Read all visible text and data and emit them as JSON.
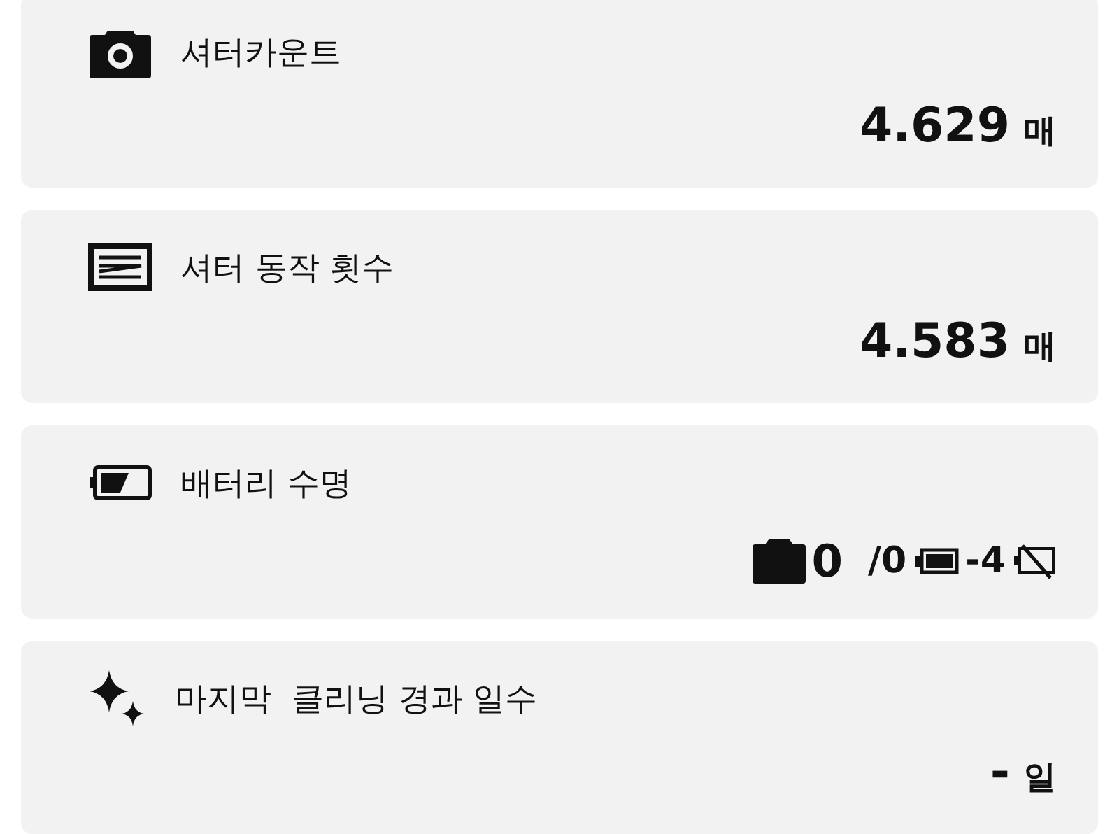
{
  "cards": [
    {
      "kind": "camera",
      "title": "셔터카운트",
      "value": "4.629",
      "unit": "매"
    },
    {
      "kind": "shutter",
      "title": "셔터 동작 횟수",
      "value": "4.583",
      "unit": "매"
    },
    {
      "kind": "battery",
      "title": "배터리 수명",
      "readings": [
        "0",
        "/0",
        "-4"
      ]
    },
    {
      "kind": "sparkle",
      "title": "마지막  클리닝 경과 일수",
      "value": "-",
      "unit": "일"
    }
  ]
}
